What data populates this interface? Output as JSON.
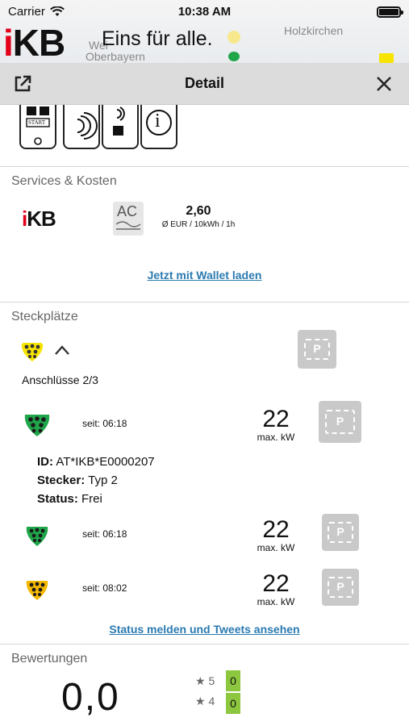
{
  "status_bar": {
    "carrier": "Carrier",
    "time": "10:38 AM"
  },
  "map": {
    "labels": [
      "Holzkirchen",
      "Oberbayern",
      "Wei"
    ]
  },
  "brand": {
    "logo_i": "i",
    "logo_rest": "KB",
    "slogan": "Eins für alle."
  },
  "header": {
    "title": "Detail",
    "open_icon": "external-link-icon",
    "close_icon": "close-icon"
  },
  "auth_methods": {
    "icons": [
      "app-start-icon",
      "nfc-card-icon",
      "rfid-card-icon",
      "info-icon"
    ],
    "start_label": "START",
    "info_glyph": "i"
  },
  "services": {
    "title": "Services & Kosten",
    "provider_logo_i": "i",
    "provider_logo_rest": "KB",
    "current_type": "AC",
    "price": "2,60",
    "price_unit": "Ø EUR / 10kWh / 1h",
    "wallet_link": "Jetzt mit Wallet laden"
  },
  "steckplaetze": {
    "title": "Steckplätze",
    "group_status_color": "#f7e400",
    "connections_label": "Anschlüsse 2/3",
    "parking_letter": "P",
    "connectors": [
      {
        "status_color": "#1fa64a",
        "since": "seit: 06:18",
        "power": "22",
        "unit": "max. kW"
      },
      {
        "status_color": "#1fa64a",
        "since": "seit: 06:18",
        "power": "22",
        "unit": "max. kW"
      },
      {
        "status_color": "#f5b800",
        "since": "seit: 08:02",
        "power": "22",
        "unit": "max. kW"
      }
    ],
    "details": {
      "id_label": "ID:",
      "id_value": "AT*IKB*E0000207",
      "plug_label": "Stecker:",
      "plug_value": "Typ 2",
      "status_label": "Status:",
      "status_value": "Frei"
    },
    "report_link": "Status melden und Tweets ansehen"
  },
  "ratings": {
    "title": "Bewertungen",
    "average": "0,0",
    "rows": [
      {
        "stars": "5",
        "count": "0"
      },
      {
        "stars": "4",
        "count": "0"
      }
    ]
  }
}
